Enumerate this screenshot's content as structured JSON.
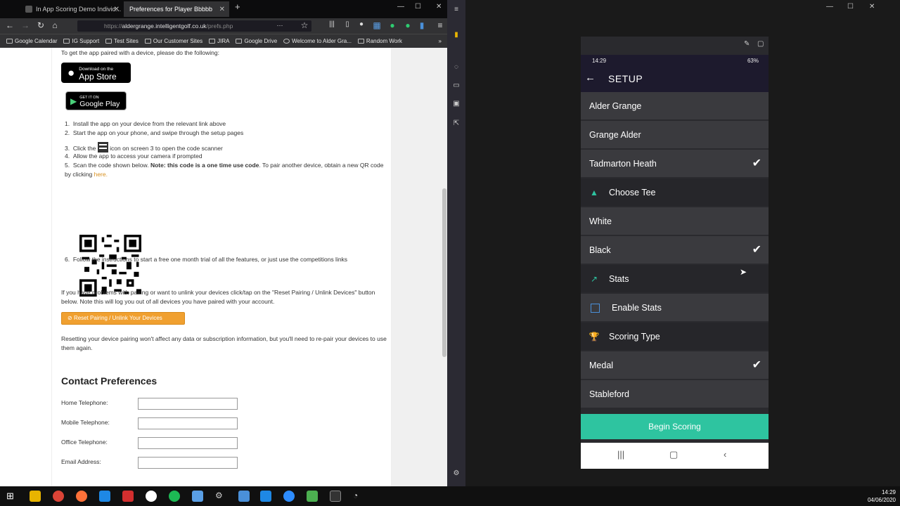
{
  "browser": {
    "tabs": [
      {
        "label": "In App Scoring Demo Individ..."
      },
      {
        "label": "Preferences for Player Bbbbb"
      }
    ],
    "url": {
      "prefix": "https://",
      "host": "aldergrange.intelligentgolf.co.uk",
      "path": "/prefs.php"
    },
    "bookmarks": [
      "Google Calendar",
      "IG Support",
      "Test Sites",
      "Our Customer Sites",
      "JIRA",
      "Google Drive",
      "Welcome to Alder Gra...",
      "Random Work"
    ]
  },
  "page": {
    "intro": "To get the app paired with a device, please do the following:",
    "appstore": {
      "small": "Download on the",
      "big": "App Store"
    },
    "googleplay": {
      "small": "GET IT ON",
      "big": "Google Play"
    },
    "steps": {
      "s1": "Install the app on your device from the relevant link above",
      "s2": "Start the app on your phone, and swipe through the setup pages",
      "s3a": "Click the",
      "s3b": "icon on screen 3 to open the code scanner",
      "s4": "Allow the app to access your camera if prompted",
      "s5a": "Scan the code shown below.",
      "s5bold": "Note: this code is a one time use code",
      "s5b": ". To pair another device, obtain a new QR code by clicking",
      "s5link": "here.",
      "s6": "Follow the instructions to start a free one month trial of all the features, or just use the competitions links"
    },
    "unlink_text": "If you have problems with pairing or want to unlink your devices click/tap on the \"Reset Pairing / Unlink Devices\" button below. Note this will log you out of all devices you have paired with your account.",
    "reset_button": "Reset Pairing / Unlink Your Devices",
    "resetting_text": "Resetting your device pairing won't affect any data or subscription information, but you'll need to re-pair your devices to use them again.",
    "contact_heading": "Contact Preferences",
    "fields": {
      "home": "Home Telephone:",
      "mobile": "Mobile Telephone:",
      "office": "Office Telephone:",
      "email": "Email Address:"
    }
  },
  "phone": {
    "time": "14:29",
    "battery": "63%",
    "title": "SETUP",
    "courses": [
      "Alder Grange",
      "Grange Alder",
      "Tadmarton Heath"
    ],
    "choose_tee": "Choose Tee",
    "tees": [
      "White",
      "Black"
    ],
    "stats": "Stats",
    "enable_stats": "Enable Stats",
    "scoring_type": "Scoring Type",
    "scoring": [
      "Medal",
      "Stableford"
    ],
    "begin": "Begin Scoring"
  },
  "taskbar": {
    "time": "14:29",
    "date": "04/06/2020"
  }
}
